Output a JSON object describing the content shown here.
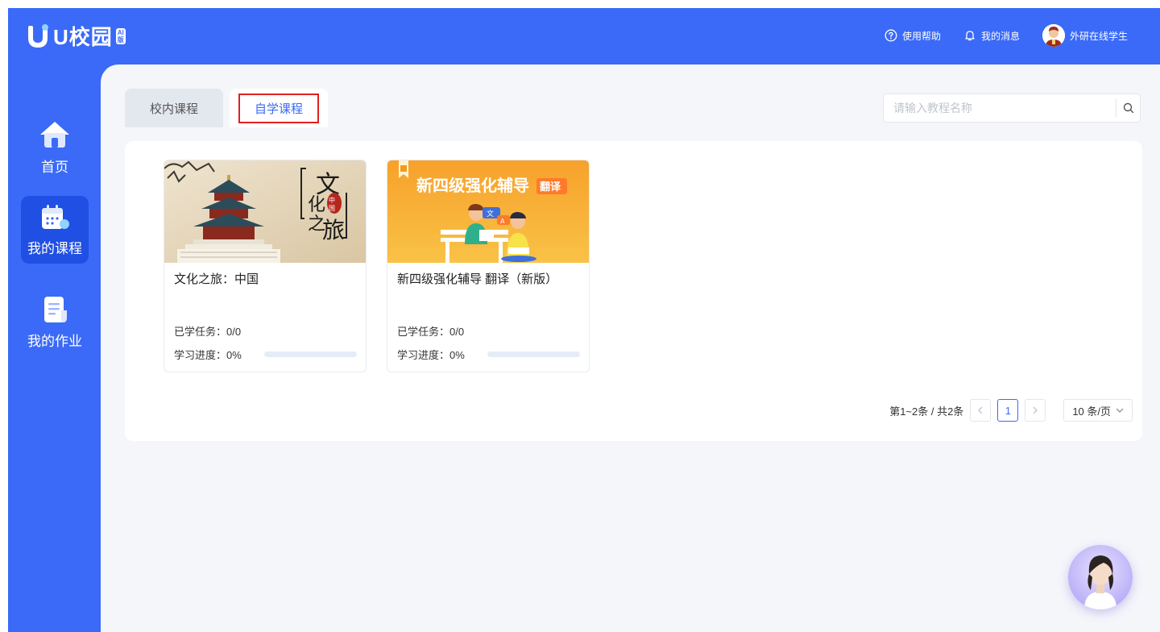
{
  "app": {
    "logo_text": "U校园",
    "logo_badge": "AI版"
  },
  "header": {
    "help_label": "使用帮助",
    "messages_label": "我的消息",
    "user_name": "外研在线学生"
  },
  "sidebar": {
    "items": [
      {
        "label": "首页",
        "icon": "home-icon",
        "active": false
      },
      {
        "label": "我的课程",
        "icon": "calendar-icon",
        "active": true
      },
      {
        "label": "我的作业",
        "icon": "document-icon",
        "active": false
      }
    ]
  },
  "tabs": [
    {
      "label": "校内课程",
      "active": false
    },
    {
      "label": "自学课程",
      "active": true
    }
  ],
  "search": {
    "placeholder": "请输入教程名称",
    "value": ""
  },
  "courses": [
    {
      "title": "文化之旅：中国",
      "cover_text": "文化之旅",
      "cover_stamp": "中国",
      "tasks_label": "已学任务：",
      "tasks_value": "0/0",
      "progress_label": "学习进度：",
      "progress_value": "0%",
      "progress": 0
    },
    {
      "title": "新四级强化辅导 翻译（新版）",
      "cover_text": "新四级强化辅导",
      "cover_tag": "翻译",
      "tasks_label": "已学任务：",
      "tasks_value": "0/0",
      "progress_label": "学习进度：",
      "progress_value": "0%",
      "progress": 0
    }
  ],
  "pagination": {
    "summary": "第1~2条 / 共2条",
    "current_page": "1",
    "page_size": "10 条/页"
  },
  "colors": {
    "brand": "#3a6af7",
    "brand_dark": "#1f4fe3",
    "highlight": "#e02020",
    "background": "#f4f6fa"
  }
}
